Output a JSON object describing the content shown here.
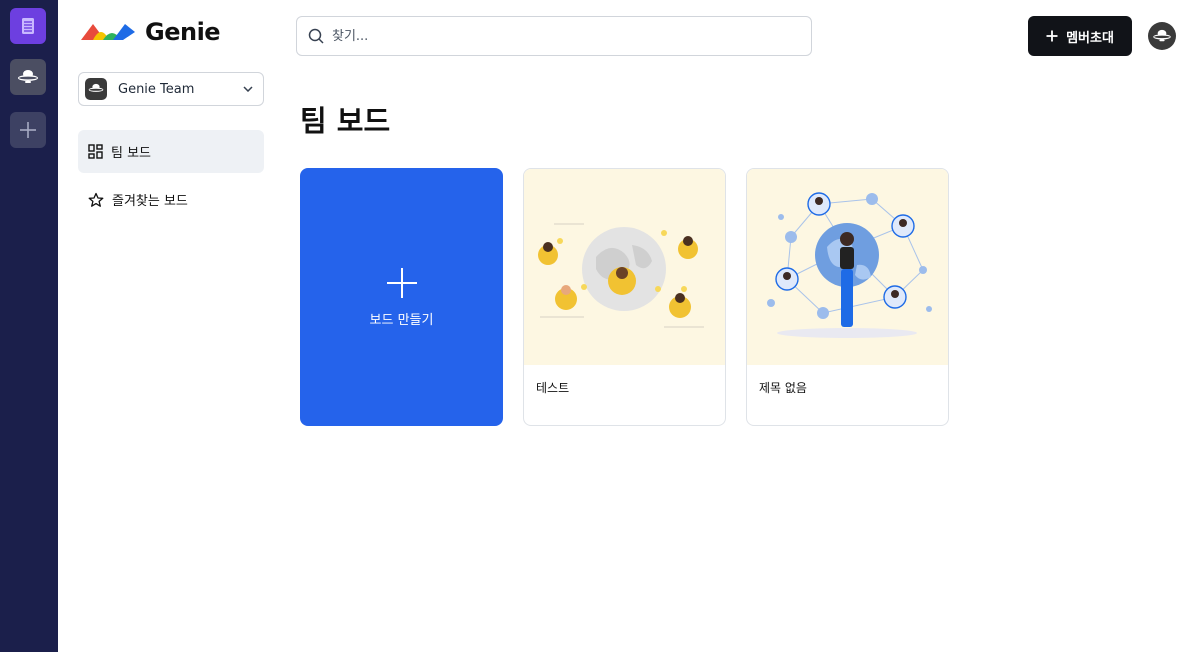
{
  "app": {
    "logo_text": "Genie"
  },
  "team_selector": {
    "name": "Genie Team"
  },
  "nav": {
    "items": [
      {
        "label": "팀 보드",
        "icon": "grid-icon",
        "active": true
      },
      {
        "label": "즐겨찾는 보드",
        "icon": "star-icon",
        "active": false
      }
    ]
  },
  "search": {
    "placeholder": "찾기..."
  },
  "header": {
    "invite_label": "멤버초대"
  },
  "main": {
    "title": "팀 보드",
    "create_label": "보드 만들기",
    "boards": [
      {
        "title": "테스트",
        "thumbnail": "people-around-globe-illustration"
      },
      {
        "title": "제목 없음",
        "thumbnail": "woman-network-globe-illustration"
      }
    ]
  },
  "colors": {
    "rail": "#1b1f4b",
    "accent": "#2563eb",
    "doc": "#6d3fe0",
    "button": "#111318",
    "thumb_bg": "#fdf7e2"
  }
}
